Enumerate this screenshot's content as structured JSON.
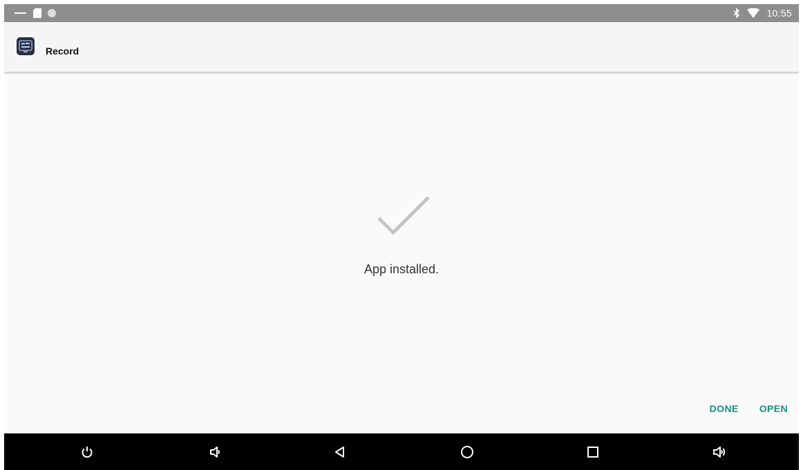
{
  "status_bar": {
    "time": "10:55",
    "icons": [
      "minus-icon",
      "sd-card-icon",
      "circle-icon",
      "bluetooth-icon",
      "wifi-icon"
    ]
  },
  "title_bar": {
    "app_name": "Record",
    "app_icon": "record-app-icon"
  },
  "content": {
    "status_icon": "checkmark-icon",
    "message": "App installed."
  },
  "actions": {
    "done_label": "DONE",
    "open_label": "OPEN"
  },
  "colors": {
    "accent": "#14907f",
    "status_bar": "#8e8e8e",
    "nav_bar": "#000000",
    "background": "#fafafa"
  },
  "nav_bar": {
    "buttons": [
      "power-icon",
      "volume-down-icon",
      "back-icon",
      "home-icon",
      "recents-icon",
      "volume-up-icon"
    ]
  }
}
